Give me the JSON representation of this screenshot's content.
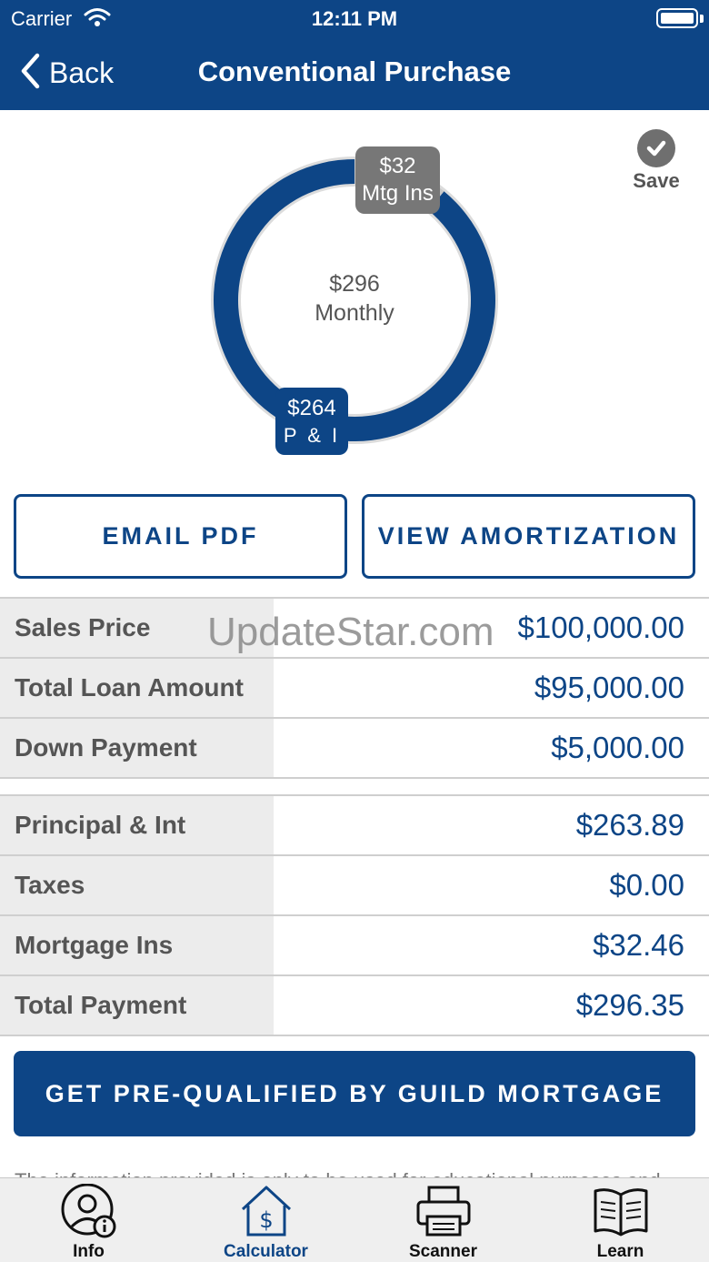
{
  "status_bar": {
    "carrier": "Carrier",
    "time": "12:11 PM"
  },
  "nav": {
    "back_label": "Back",
    "title": "Conventional Purchase"
  },
  "save_label": "Save",
  "payment_chart": {
    "monthly_total": "$296",
    "monthly_label": "Monthly",
    "segments": [
      {
        "amount": "$32",
        "label": "Mtg Ins",
        "value": 32.46,
        "color": "#777777"
      },
      {
        "amount": "$264",
        "label": "P & I",
        "value": 263.89,
        "color": "#0d4586"
      }
    ]
  },
  "buttons": {
    "email_pdf": "EMAIL PDF",
    "view_amortization": "VIEW AMORTIZATION"
  },
  "loan_rows": [
    {
      "label": "Sales Price",
      "value": "$100,000.00"
    },
    {
      "label": "Total Loan Amount",
      "value": "$95,000.00"
    },
    {
      "label": "Down Payment",
      "value": "$5,000.00"
    }
  ],
  "payment_rows": [
    {
      "label": "Principal & Int",
      "value": "$263.89"
    },
    {
      "label": "Taxes",
      "value": "$0.00"
    },
    {
      "label": "Mortgage Ins",
      "value": "$32.46"
    },
    {
      "label": "Total Payment",
      "value": "$296.35"
    }
  ],
  "watermark": "UpdateStar.com",
  "cta_label": "GET PRE-QUALIFIED BY GUILD MORTGAGE",
  "disclaimer": "The information provided is only to be used for educational purposes and",
  "tabs": [
    {
      "label": "Info",
      "icon": "person-info-icon"
    },
    {
      "label": "Calculator",
      "icon": "house-dollar-icon"
    },
    {
      "label": "Scanner",
      "icon": "printer-icon"
    },
    {
      "label": "Learn",
      "icon": "open-book-icon"
    }
  ],
  "colors": {
    "brand": "#0d4586",
    "label_bg": "#ececec",
    "muted": "#777777"
  }
}
